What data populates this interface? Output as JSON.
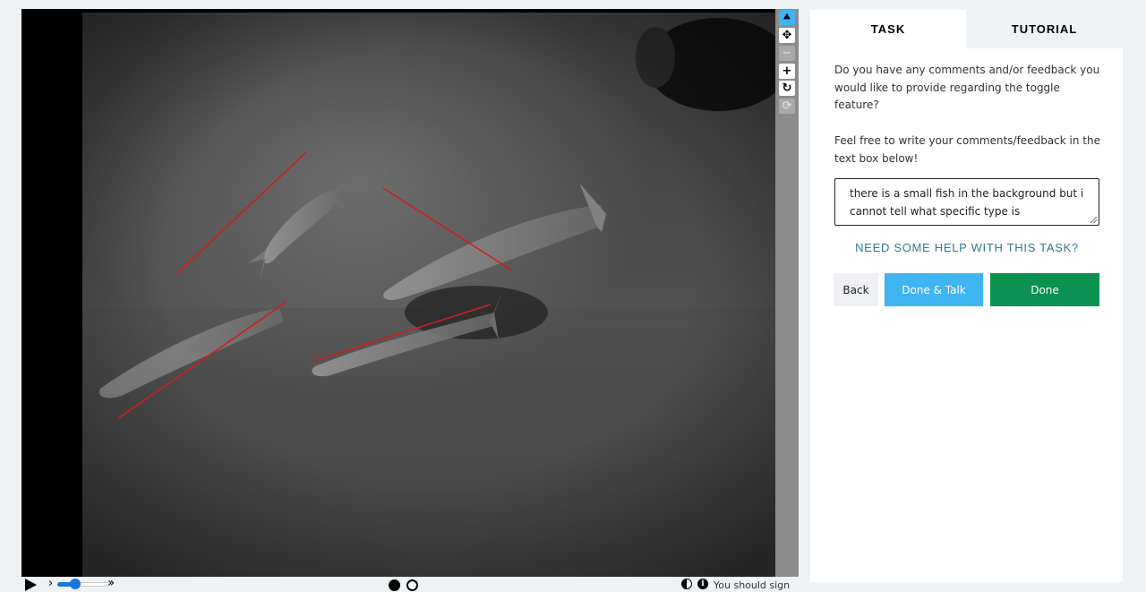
{
  "viewer": {
    "tools": [
      {
        "name": "pointer-icon",
        "glyph": "⯅"
      },
      {
        "name": "move-icon",
        "glyph": "✥"
      },
      {
        "name": "zoom-out-icon",
        "glyph": "−"
      },
      {
        "name": "zoom-in-icon",
        "glyph": "+"
      },
      {
        "name": "rotate-icon",
        "glyph": "↻"
      },
      {
        "name": "reset-icon",
        "glyph": "⟳"
      }
    ],
    "controls": {
      "play_icon": "play-icon",
      "speed_level": 0.35,
      "sign_in_text": "You should sign in!"
    }
  },
  "panel": {
    "tabs": {
      "task": "TASK",
      "tutorial": "TUTORIAL"
    },
    "question": "Do you have any comments and/or feedback you would like to provide regarding the toggle feature?",
    "instruction": "Feel free to write your comments/feedback in the text box below!",
    "comment_value": "there is a small fish in the background but i cannot tell what specific type is",
    "help_link": "NEED SOME HELP WITH THIS TASK?",
    "buttons": {
      "back": "Back",
      "done_talk": "Done & Talk",
      "done": "Done"
    },
    "colors": {
      "done_talk": "#3fb4f2",
      "done": "#0b9150",
      "help": "#2c7c8c",
      "annotation": "#cc1f1f"
    }
  }
}
